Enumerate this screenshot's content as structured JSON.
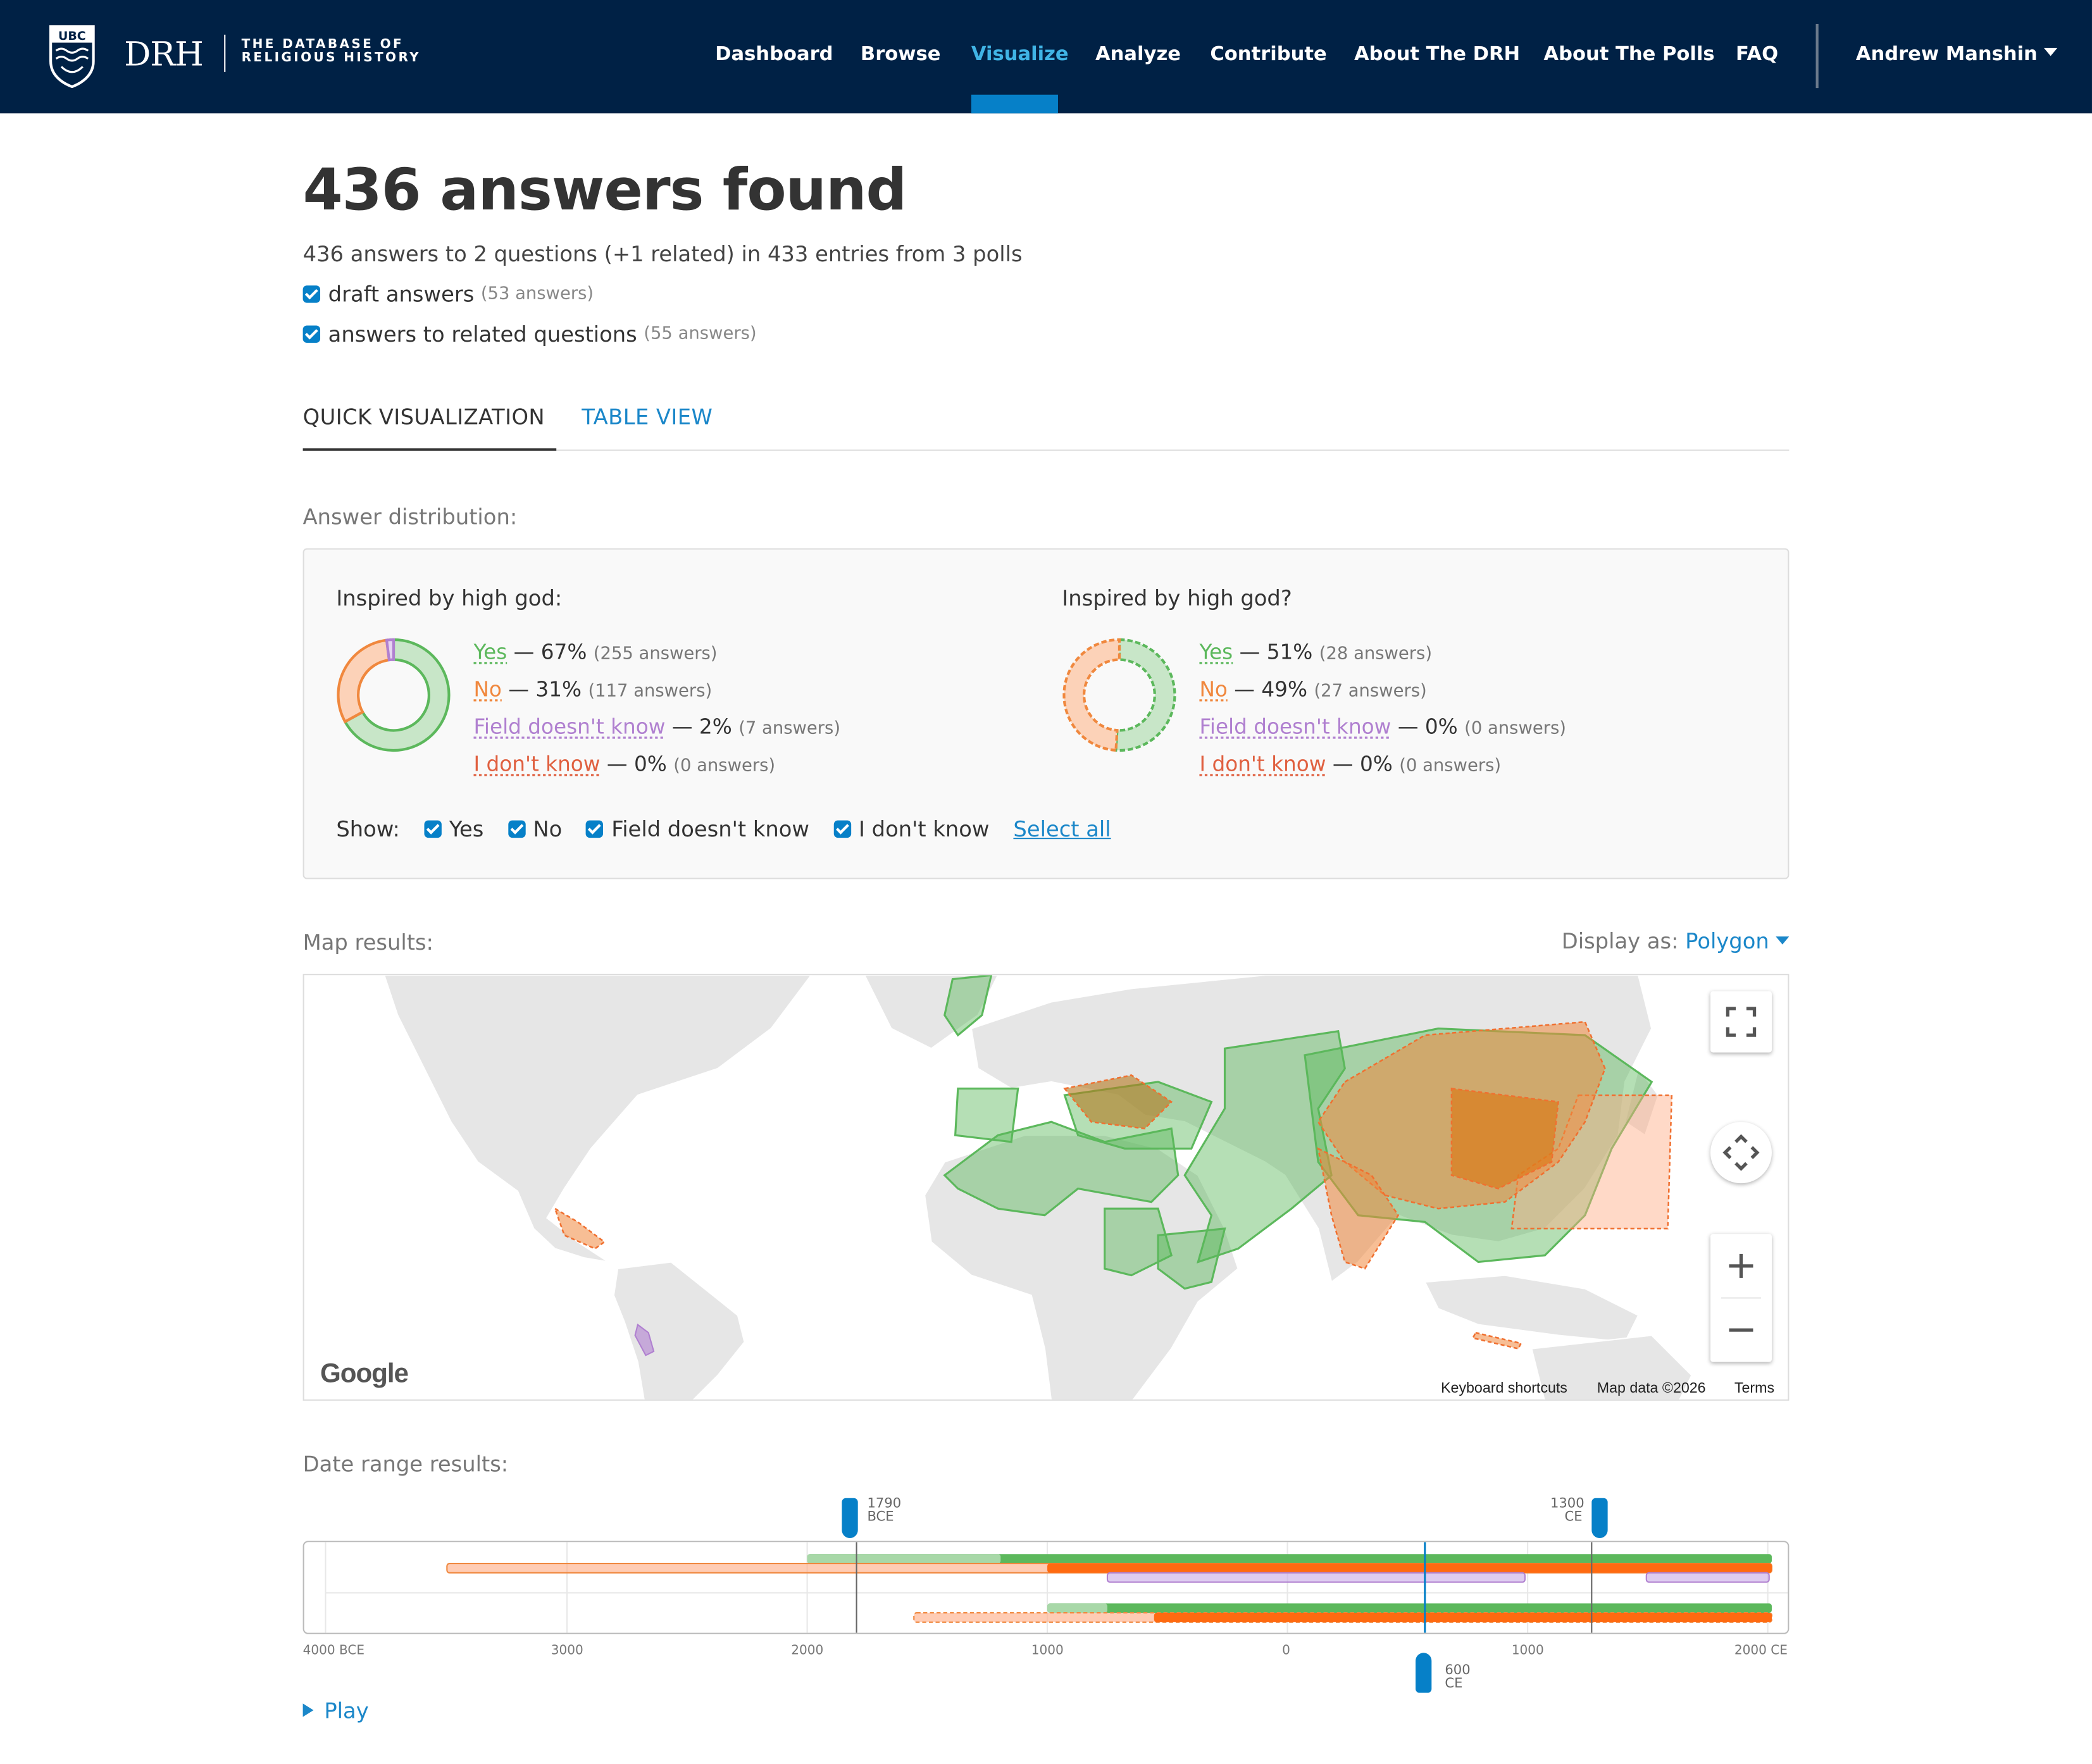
{
  "header": {
    "logo_ubc": "UBC",
    "logo_drh": "DRH",
    "logo_sub_1": "THE DATABASE OF",
    "logo_sub_2": "RELIGIOUS HISTORY",
    "nav": [
      "Dashboard",
      "Browse",
      "Visualize",
      "Analyze",
      "Contribute",
      "About The DRH",
      "About The Polls",
      "FAQ"
    ],
    "active_nav": "Visualize",
    "user": "Andrew Manshin",
    "colors": {
      "bg": "#002145",
      "active": "#40b4e5",
      "indicator": "#0680c8"
    }
  },
  "results": {
    "title": "436 answers found",
    "summary": "436 answers to 2 questions (+1 related) in 433 entries from 3 polls",
    "filters": [
      {
        "label": "draft answers",
        "count": "(53 answers)",
        "checked": true
      },
      {
        "label": "answers to related questions",
        "count": "(55 answers)",
        "checked": true
      }
    ]
  },
  "tabs": [
    "QUICK VISUALIZATION",
    "TABLE VIEW"
  ],
  "distribution": {
    "heading": "Answer distribution:",
    "colors": {
      "yes": "#5cb85c",
      "no": "#f0883e",
      "field": "#b080d0",
      "idk": "#e06040"
    },
    "questions": [
      {
        "title": "Inspired by high god:",
        "answers": [
          {
            "label": "Yes",
            "pct": "— 67%",
            "count": "(255 answers)",
            "value": 67
          },
          {
            "label": "No",
            "pct": "— 31%",
            "count": "(117 answers)",
            "value": 31
          },
          {
            "label": "Field doesn't know",
            "pct": "— 2%",
            "count": "(7 answers)",
            "value": 2
          },
          {
            "label": "I don't know",
            "pct": "— 0%",
            "count": "(0 answers)",
            "value": 0
          }
        ]
      },
      {
        "title": "Inspired by high god?",
        "answers": [
          {
            "label": "Yes",
            "pct": "— 51%",
            "count": "(28 answers)",
            "value": 51
          },
          {
            "label": "No",
            "pct": "— 49%",
            "count": "(27 answers)",
            "value": 49
          },
          {
            "label": "Field doesn't know",
            "pct": "— 0%",
            "count": "(0 answers)",
            "value": 0
          },
          {
            "label": "I don't know",
            "pct": "— 0%",
            "count": "(0 answers)",
            "value": 0
          }
        ]
      }
    ],
    "show_label": "Show:",
    "show_options": [
      "Yes",
      "No",
      "Field doesn't know",
      "I don't know"
    ],
    "select_all": "Select all"
  },
  "map": {
    "heading": "Map results:",
    "display_label": "Display as:",
    "display_value": "Polygon",
    "google": "Google",
    "attribution": [
      "Keyboard shortcuts",
      "Map data ©2026",
      "Terms"
    ],
    "controls": [
      "fullscreen-icon",
      "move-icon",
      "zoom-in-icon",
      "zoom-out-icon"
    ]
  },
  "dates": {
    "heading": "Date range results:",
    "ticks": [
      "4000 BCE",
      "3000",
      "2000",
      "1000",
      "0",
      "1000",
      "2000 CE"
    ],
    "range_start": {
      "year": "1790",
      "era": "BCE"
    },
    "range_end": {
      "year": "1300",
      "era": "CE"
    },
    "current": {
      "year": "600",
      "era": "CE"
    },
    "play": "Play"
  }
}
